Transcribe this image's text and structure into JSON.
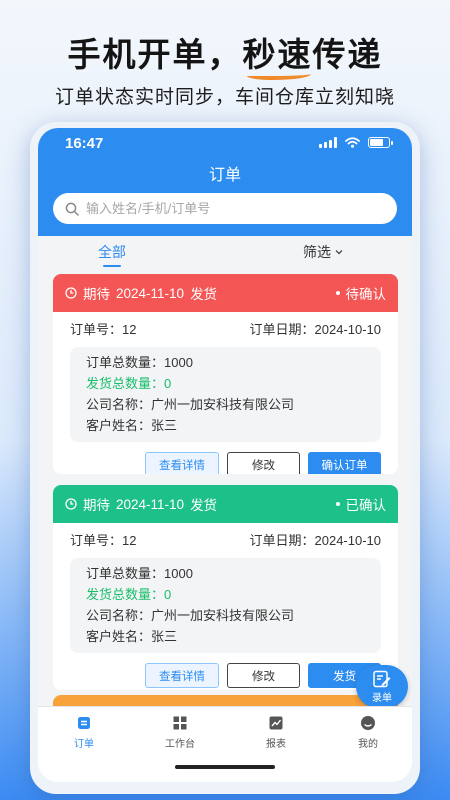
{
  "promo": {
    "title_part1": "手机开单，",
    "title_highlight": "秒速",
    "title_part2": "传递",
    "subtitle": "订单状态实时同步，车间仓库立刻知晓"
  },
  "status_bar": {
    "time": "16:47"
  },
  "header": {
    "title": "订单"
  },
  "search": {
    "placeholder": "输入姓名/手机/订单号",
    "icon": "search-icon"
  },
  "tabs": {
    "all": "全部",
    "filter": "筛选"
  },
  "orders": [
    {
      "expect_label": "期待",
      "expect_date": "2024-11-10",
      "expect_action": "发货",
      "status": "待确认",
      "header_color": "#f45555",
      "order_no_label": "订单号：",
      "order_no": "12",
      "order_date_label": "订单日期：",
      "order_date": "2024-10-10",
      "total_qty_label": "订单总数量：",
      "total_qty": "1000",
      "shipped_qty_label": "发货总数量：",
      "shipped_qty": "0",
      "company_label": "公司名称：",
      "company": "广州一加安科技有限公司",
      "customer_label": "客户姓名：",
      "customer": "张三",
      "btn_detail": "查看详情",
      "btn_edit": "修改",
      "btn_primary": "确认订单"
    },
    {
      "expect_label": "期待",
      "expect_date": "2024-11-10",
      "expect_action": "发货",
      "status": "已确认",
      "header_color": "#1ec08a",
      "order_no_label": "订单号：",
      "order_no": "12",
      "order_date_label": "订单日期：",
      "order_date": "2024-10-10",
      "total_qty_label": "订单总数量：",
      "total_qty": "1000",
      "shipped_qty_label": "发货总数量：",
      "shipped_qty": "0",
      "company_label": "公司名称：",
      "company": "广州一加安科技有限公司",
      "customer_label": "客户姓名：",
      "customer": "张三",
      "btn_detail": "查看详情",
      "btn_edit": "修改",
      "btn_primary": "发货"
    }
  ],
  "fab": {
    "label": "录单",
    "icon": "edit-icon"
  },
  "tabbar": [
    {
      "label": "订单",
      "icon": "order-icon",
      "active": true
    },
    {
      "label": "工作台",
      "icon": "grid-icon",
      "active": false
    },
    {
      "label": "报表",
      "icon": "chart-icon",
      "active": false
    },
    {
      "label": "我的",
      "icon": "profile-icon",
      "active": false
    }
  ],
  "colors": {
    "primary": "#2d8cf0",
    "green": "#19be6b",
    "orange": "#f7a23a"
  }
}
